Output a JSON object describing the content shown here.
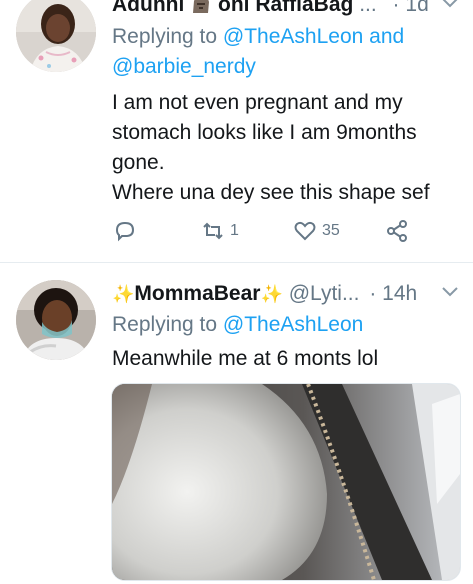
{
  "tweet1": {
    "name_part1": "Adunni",
    "name_part2": "oni RaffiaBag",
    "ellipsis": "...",
    "dot": "·",
    "time": "1d",
    "replying_label": "Replying to",
    "mentions": [
      "@TheAshLeon",
      "and",
      "@barbie_nerdy"
    ],
    "text": [
      "I am not even pregnant and my",
      "stomach looks like I am 9months",
      "gone.",
      "Where una dey see this shape sef"
    ],
    "retweets": "1",
    "likes": "35",
    "icons": [
      "reply-icon",
      "retweet-icon",
      "like-icon",
      "share-icon",
      "chevron-down-icon"
    ]
  },
  "tweet2": {
    "sparkle": "✨",
    "name": "MommaBear",
    "handle": "@Lyti...",
    "dot": "·",
    "time": "14h",
    "replying_label": "Replying to",
    "mention": "@TheAshLeon",
    "text": "Meanwhile me at 6 monts lol"
  },
  "colors": {
    "link": "#1da1f2",
    "secondary": "#657786",
    "primary_text": "#14171a",
    "divider": "#e6ecf0"
  }
}
